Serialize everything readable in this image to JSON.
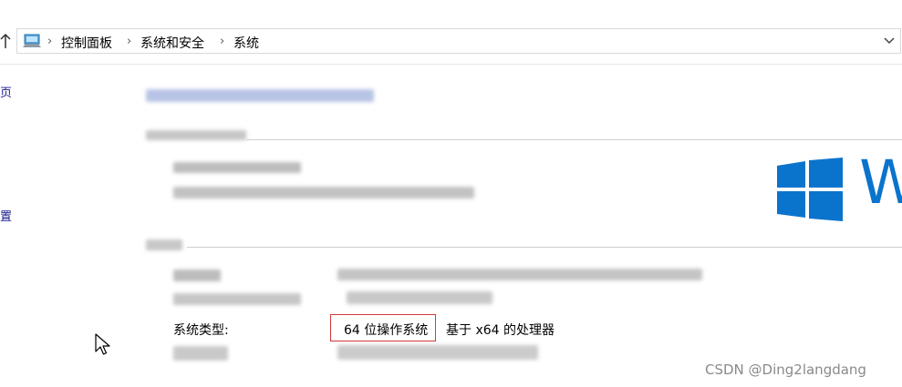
{
  "breadcrumb": {
    "items": [
      "控制面板",
      "系统和安全",
      "系统"
    ]
  },
  "left_nav": {
    "frag_1": "页",
    "frag_2": "置"
  },
  "brand": {
    "logo_text": "W",
    "logo_color": "#0a74cc"
  },
  "system": {
    "type_label": "系统类型:",
    "os_bits": "64 位操作系统",
    "processor": "基于 x64 的处理器",
    "highlight_color": "#d23a3a"
  },
  "watermark": {
    "text": "CSDN @Ding2langdang"
  },
  "icons": [
    "up-arrow-icon",
    "computer-icon",
    "chevron-right-icon",
    "chevron-down-icon",
    "windows-logo-icon",
    "mouse-cursor-icon"
  ]
}
